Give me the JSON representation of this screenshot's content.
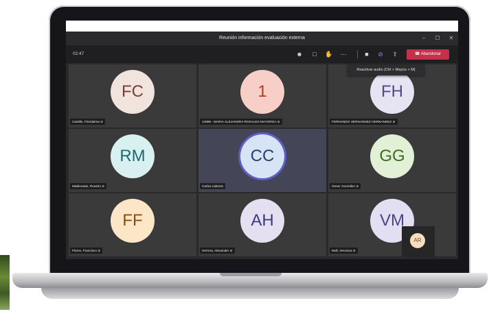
{
  "window": {
    "title": "Reunión información evaluación externa",
    "minimize_icon": "minimize-icon",
    "maximize_icon": "maximize-icon",
    "close_icon": "close-icon"
  },
  "toolbar": {
    "timer": "02:47",
    "icons": [
      "participants-icon",
      "chat-icon",
      "raise-hand-icon",
      "more-icon",
      "camera-off-icon",
      "mic-off-icon",
      "share-screen-icon"
    ],
    "leave_label": "Abandonar",
    "tooltip": "Reactivar audio (Ctrl + Mayús + M)"
  },
  "participants": [
    {
      "initials": "FC",
      "name": "Castillo, Floridalma",
      "bg": "#f1e4df",
      "fg": "#7a3e2e",
      "muted": true
    },
    {
      "initials": "1",
      "name": "14999 - MARIA ALEJANDRA ROSALES MAYORGA",
      "bg": "#f8cfc6",
      "fg": "#b43b1c",
      "muted": true
    },
    {
      "initials": "FH",
      "name": "FERNANDO HERNANDEZ HERNANDEZ",
      "bg": "#e6e3f2",
      "fg": "#4e4a8c",
      "muted": true
    },
    {
      "initials": "RM",
      "name": "Maldonado, Rosario",
      "bg": "#d9f0f0",
      "fg": "#1e6a72",
      "muted": true
    },
    {
      "initials": "CC",
      "name": "Carlos cabrera",
      "bg": "#d6e4f5",
      "fg": "#25436b",
      "muted": false,
      "active": true
    },
    {
      "initials": "GG",
      "name": "Geser González",
      "bg": "#e2f0d6",
      "fg": "#3d6b1f",
      "muted": true
    },
    {
      "initials": "FF",
      "name": "Flores, Francisco",
      "bg": "#fbe7c8",
      "fg": "#8a4a12",
      "muted": true
    },
    {
      "initials": "AH",
      "name": "Herrera, Alexander",
      "bg": "#e4e0f2",
      "fg": "#3f3a7a",
      "muted": true
    },
    {
      "initials": "VM",
      "name": "Mull, Veronica",
      "bg": "#e2dff2",
      "fg": "#4a4588",
      "muted": true
    }
  ],
  "self_view": {
    "initials": "AR"
  }
}
